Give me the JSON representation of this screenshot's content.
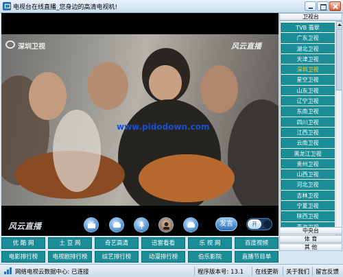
{
  "window": {
    "title": "电视台在线直播_您身边的高清电视机!"
  },
  "player": {
    "channel_logo": "深圳卫视",
    "watermark": "风云直播",
    "url_watermark": "www.pidodown.com",
    "controls_logo": "风云直播",
    "speak_button": "发言",
    "toggle_label": "开"
  },
  "sidebar": {
    "categories_top": [
      {
        "label": "卫视台"
      }
    ],
    "channels": [
      {
        "label": "TVB 翡翠"
      },
      {
        "label": "广东卫视"
      },
      {
        "label": "湖北卫视"
      },
      {
        "label": "天津卫视"
      },
      {
        "label": "深圳卫视",
        "active": true
      },
      {
        "label": "星空卫视"
      },
      {
        "label": "山东卫视"
      },
      {
        "label": "辽宁卫视"
      },
      {
        "label": "东南卫视"
      },
      {
        "label": "四川卫视"
      },
      {
        "label": "江西卫视"
      },
      {
        "label": "云南卫视"
      },
      {
        "label": "黑龙江卫视"
      },
      {
        "label": "贵州卫视"
      },
      {
        "label": "山西卫视"
      },
      {
        "label": "河北卫视"
      },
      {
        "label": "吉林卫视"
      },
      {
        "label": "宁夏卫视"
      },
      {
        "label": "陕西卫视"
      },
      {
        "label": "青海卫视"
      }
    ],
    "categories_bottom": [
      {
        "label": "中央台"
      },
      {
        "label": "体 育"
      },
      {
        "label": "其 他"
      }
    ]
  },
  "sites": {
    "row1": [
      "优 酷 网",
      "土 豆 网",
      "奇艺高清",
      "迅雷看看",
      "乐 视 网",
      "百度视频"
    ],
    "row2": [
      "电影排行榜",
      "电视剧排行榜",
      "综艺排行榜",
      "动漫排行榜",
      "伯乐影院",
      "直播节目单"
    ]
  },
  "status": {
    "connection": "网络电视云数据中心: 已连接",
    "version": "程序版本号: 13.1",
    "online_update": "在线更新",
    "about": "关于我们",
    "feedback": "留言反馈"
  },
  "colors": {
    "teal_button": "#1a8d96",
    "active_channel_text": "#ffd43a",
    "window_bg": "#d6e6f2"
  },
  "icons": [
    "tv-icon",
    "speaker-icon",
    "microphone-icon",
    "avatar-icon",
    "network-icon"
  ]
}
